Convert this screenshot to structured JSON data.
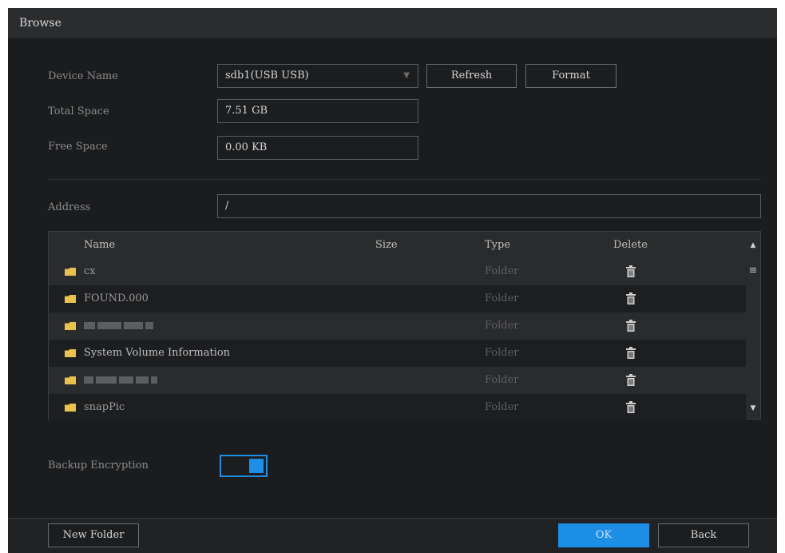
{
  "window": {
    "title": "Browse"
  },
  "device": {
    "name_label": "Device Name",
    "name_value": "sdb1(USB USB)",
    "refresh_label": "Refresh",
    "format_label": "Format",
    "total_label": "Total Space",
    "total_value": "7.51 GB",
    "free_label": "Free Space",
    "free_value": "0.00 KB"
  },
  "address": {
    "label": "Address",
    "value": "/"
  },
  "table": {
    "headers": {
      "name": "Name",
      "size": "Size",
      "type": "Type",
      "delete": "Delete"
    },
    "rows": [
      {
        "name": "cx",
        "size": "",
        "type": "Folder"
      },
      {
        "name": "FOUND.000",
        "size": "",
        "type": "Folder"
      },
      {
        "name": "",
        "size": "",
        "type": "Folder",
        "obscured": true
      },
      {
        "name": "System Volume Information",
        "size": "",
        "type": "Folder"
      },
      {
        "name": "",
        "size": "",
        "type": "Folder",
        "obscured": true
      },
      {
        "name": "snapPic",
        "size": "",
        "type": "Folder"
      }
    ]
  },
  "encryption": {
    "label": "Backup Encryption",
    "enabled": true
  },
  "footer": {
    "new_folder_label": "New Folder",
    "ok_label": "OK",
    "back_label": "Back"
  },
  "icons": {
    "folder": "folder-icon",
    "delete": "trash-icon"
  },
  "colors": {
    "accent": "#1e8fe6",
    "folder": "#e8c24a",
    "background": "#1b1c1e"
  }
}
